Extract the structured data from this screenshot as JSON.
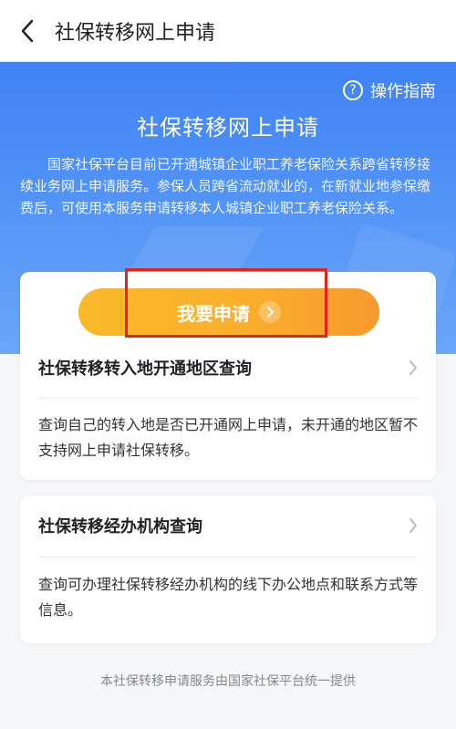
{
  "nav": {
    "title": "社保转移网上申请"
  },
  "hero": {
    "guide_label": "操作指南",
    "title": "社保转移网上申请",
    "description": "国家社保平台目前已开通城镇企业职工养老保险关系跨省转移接续业务网上申请服务。参保人员跨省流动就业的，在新就业地参保缴费后，可使用本服务申请转移本人城镇企业职工养老保险关系。"
  },
  "apply_button": {
    "label": "我要申请"
  },
  "cards": [
    {
      "title": "社保转移转入地开通地区查询",
      "description": "查询自己的转入地是否已开通网上申请，未开通的地区暂不支持网上申请社保转移。"
    },
    {
      "title": "社保转移经办机构查询",
      "description": "查询可办理社保转移经办机构的线下办公地点和联系方式等信息。"
    }
  ],
  "footer": {
    "text": "本社保转移申请服务由国家社保平台统一提供"
  },
  "colors": {
    "hero_blue": "#3f82f4",
    "button_orange": "#f9b82a",
    "highlight_red": "#e0241b"
  }
}
